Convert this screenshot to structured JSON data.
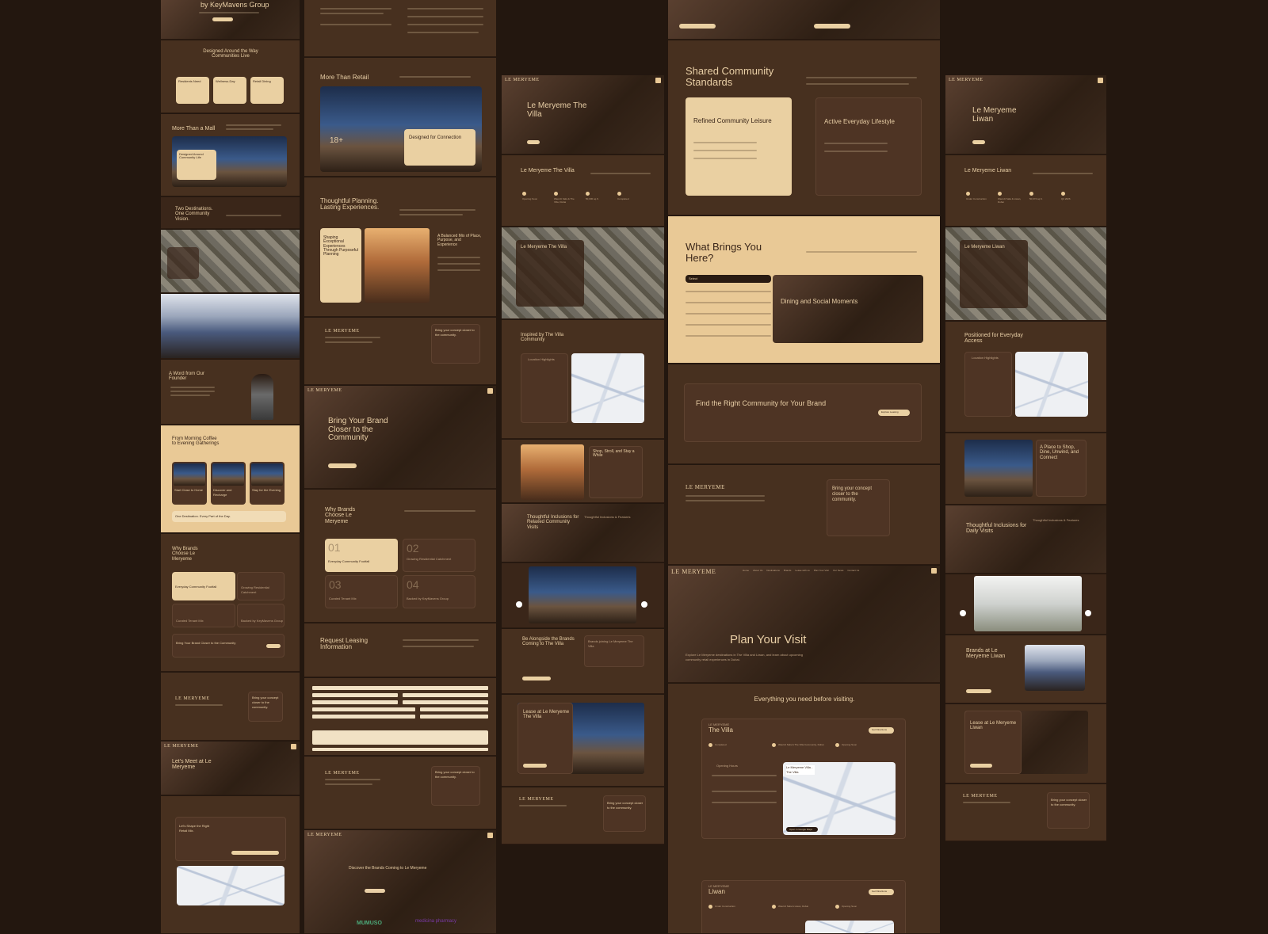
{
  "brand": {
    "logo": "LE MERYEME",
    "group": "by KeyMavens Group"
  },
  "nav": {
    "links": [
      "Home",
      "About Us",
      "Destinations",
      "Brands",
      "Lease with us",
      "Plan Your Visit",
      "Our News",
      "Contact Us"
    ]
  },
  "col1": {
    "hero_title": "by KeyMavens Group",
    "designed_title": "Designed Around the Way Communities Live",
    "designed_cards": [
      "Residents Need",
      "Wellness-Day",
      "Retail Dining"
    ],
    "more_than_mall": "More Than a Mall",
    "designed_around": "Designed Around Community Life",
    "two_destinations": "Two Destinations. One Community Vision.",
    "founder": "A Word from Our Founder",
    "morning_title": "From Morning Coffee to Evening Gatherings",
    "morning_cards": [
      "Start Close to Home",
      "Discover and Recharge",
      "Stay for the Evening"
    ],
    "one_destination": "One Destination. Every Part of the Day.",
    "why_brands": "Why Brands Choose Le Meryeme",
    "why_cards": [
      "Everyday Community Footfall",
      "Growing Residential Catchment",
      "Curated Tenant Mix",
      "Backed by KeyMavens Group"
    ],
    "bring_brand": "Bring Your Brand Closer to the Community",
    "footer_cta": "Bring your concept closer to the community.",
    "lets_meet": "Let's Meet at Le Meryeme",
    "shape_retail": "Let's Shape the Right Retail Mix."
  },
  "col2": {
    "more_than_retail": "More Than Retail",
    "stat_number": "18+",
    "designed_connection": "Designed for Connection",
    "thoughtful_title": "Thoughtful Planning. Lasting Experiences.",
    "shaping": "Shaping Exceptional Experiences Through Purposeful Planning",
    "balanced": "A Balanced Mix of Place, Purpose, and Experience",
    "footer_cta": "Bring your concept closer to the community.",
    "bring_brand_title": "Bring Your Brand Closer to the Community",
    "why_brands": "Why Brands Choose Le Meryeme",
    "why_cards": [
      "Everyday Community Footfall",
      "Growing Residential Catchment",
      "Curated Tenant Mix",
      "Backed by KeyMavens Group"
    ],
    "why_numbers": [
      "01",
      "02",
      "03",
      "04"
    ],
    "request_leasing": "Request Leasing Information",
    "footer_cta2": "Bring your concept closer to the community.",
    "discover": "Discover the Brands Coming to Le Meryeme",
    "brand_logos": [
      "MUMUSO",
      "medicina pharmacy"
    ]
  },
  "col3": {
    "villa_hero": "Le Meryeme The Villa",
    "villa_title": "Le Meryeme The Villa",
    "villa_stats": [
      "Opening Soon",
      "Wasl Al Safa & The Villa, Dubai",
      "50,000 sq.ft.",
      "Completed"
    ],
    "villa_about": "Le Meryeme The Villa",
    "inspired": "Inspired by The Villa Community",
    "location_highlights": "Location Highlights",
    "shop_stroll": "Shop, Stroll, and Stay a While",
    "thoughtful_inclusions": "Thoughtful Inclusions for Relaxed Community Visits",
    "inclusions_features": "Thoughtful Inclusions & Features",
    "brands_coming": "Be Alongside the Brands Coming to The Villa",
    "brands_joining": "Brands joining Le Meryeme The Villa",
    "lease_villa": "Lease at Le Meryeme The Villa",
    "footer_cta": "Bring your concept closer to the community."
  },
  "col4": {
    "shared_title": "Shared Community Standards",
    "refined": "Refined Community Leisure",
    "active": "Active Everyday Lifestyle",
    "what_brings": "What Brings You Here?",
    "select_label": "Select",
    "dining": "Dining and Social Moments",
    "find_community": "Find the Right Community for Your Brand",
    "explore_leasing": "Explore Leasing",
    "footer_cta": "Bring your concept closer to the community.",
    "plan_visit": "Plan Your Visit",
    "plan_sub": "Explore Le Meryeme destinations in The Villa and Liwan, and learn about upcoming community retail experiences in Dubai.",
    "everything": "Everything you need before visiting.",
    "villa_card_label": "LE MERYEME",
    "villa_card_title": "The Villa",
    "villa_card_button": "Get Directions",
    "villa_card_stats": [
      "Completed",
      "Wasl Al Safa & The Villa Community, Dubai",
      "Opening Soon"
    ],
    "opening_hours": "Opening Hours",
    "map_label": "Le Meryeme Villa - The Villa",
    "open_google": "Open in Google Maps",
    "liwan_card_label": "LE MERYEME",
    "liwan_card_title": "Liwan",
    "liwan_card_button": "Get Directions",
    "liwan_card_stats": [
      "Under Construction",
      "Wasl Al Safa & Liwan, Dubai",
      "Opening Soon"
    ]
  },
  "col5": {
    "liwan_hero": "Le Meryeme Liwan",
    "liwan_title": "Le Meryeme Liwan",
    "liwan_stats": [
      "Under Construction",
      "Wasl Al Safa & Liwan, Dubai",
      "50,674 sq.ft.",
      "Q4 2026"
    ],
    "liwan_about": "Le Meryeme Liwan",
    "positioned": "Positioned for Everyday Access",
    "location_highlights": "Location Highlights",
    "place_to_shop": "A Place to Shop, Dine, Unwind, and Connect",
    "thoughtful": "Thoughtful Inclusions for Daily Visits",
    "inclusions_features": "Thoughtful Inclusions & Features",
    "brands_liwan": "Brands at Le Meryeme Liwan",
    "lease_liwan": "Lease at Le Meryeme Liwan",
    "footer_cta": "Bring your concept closer to the community."
  }
}
